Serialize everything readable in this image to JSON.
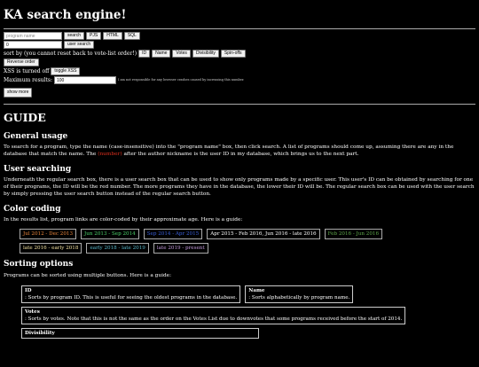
{
  "title": "KA search engine!",
  "search": {
    "program_placeholder": "program name",
    "search_label": "search",
    "pjs_label": "PJS",
    "html_label": "HTML",
    "sql_label": "SQL",
    "user_value": "0",
    "user_search_label": "user search"
  },
  "sort": {
    "label": "sort by (you cannot reset back to vote-list order!)",
    "buttons": [
      "ID",
      "Name",
      "Votes",
      "Divisibility",
      "Spin-offs"
    ],
    "reverse_label": "Reverse order"
  },
  "xss": {
    "status": "XSS is turned off",
    "toggle_label": "toggle XSS"
  },
  "max_results": {
    "label": "Maximum results:",
    "value": "100",
    "note": "I am not responsible for any browser crashes caused by increasing this number."
  },
  "show_more_label": "show more",
  "guide": {
    "title": "GUIDE",
    "general_heading": "General usage",
    "general_p1": "To search for a program, type the name (case-insensitive) into the \"program name\" box, then click search. A list of programs should come up, assuming there are any in the database that match the name. The",
    "general_number_word": "(number)",
    "general_p2": "after the author nickname is the user ID in my database, which brings us to the next part.",
    "user_heading": "User searching",
    "user_p": "Underneath the regular search box, there is a user search box that can be used to show only programs made by a specific user. This user's ID can be obtained by searching for one of their programs, the ID will be the red number. The more programs they have in the database, the lower their ID will be. The regular search box can be used with the user search by simply pressing the user search button instead of the regular search button.",
    "color_heading": "Color coding",
    "color_p": "In the results list, program links are color-coded by their approximate age. Here is a guide:",
    "color_badges": [
      {
        "label": "Jul 2012 - Dec 2013",
        "color": "#e8843a"
      },
      {
        "label": "Jun 2013 - Sep 2014",
        "color": "#4cd16a"
      },
      {
        "label": "Sep 2014 - Apr 2015",
        "color": "#3a5fd9"
      },
      {
        "label": "Apr 2015 - Feb 2016, Jun 2016 - late 2016",
        "color": "#ffffff"
      },
      {
        "label": "Feb 2016 - Jun 2016",
        "color": "#5fa84a"
      },
      {
        "label": "late 2016 - early 2018",
        "color": "#f0e0a0"
      },
      {
        "label": "early 2018 - late 2019",
        "color": "#59b7c9"
      },
      {
        "label": "late 2019 - present",
        "color": "#c49adc"
      }
    ],
    "sorting_heading": "Sorting options",
    "sorting_p": "Programs can be sorted using multiple buttons. Here is a guide:",
    "sort_id_title": "ID",
    "sort_id_desc": ": Sorts by program ID. This is useful for seeing the oldest programs in the database.",
    "sort_name_title": "Name",
    "sort_name_desc": ": Sorts alphabetically by program name.",
    "sort_votes_title": "Votes",
    "sort_votes_desc": ": Sorts by votes. Note that this is not the same as the order on the Votes List due to downvotes that some programs received before the start of 2014.",
    "sort_div_title": "Divisibility"
  }
}
